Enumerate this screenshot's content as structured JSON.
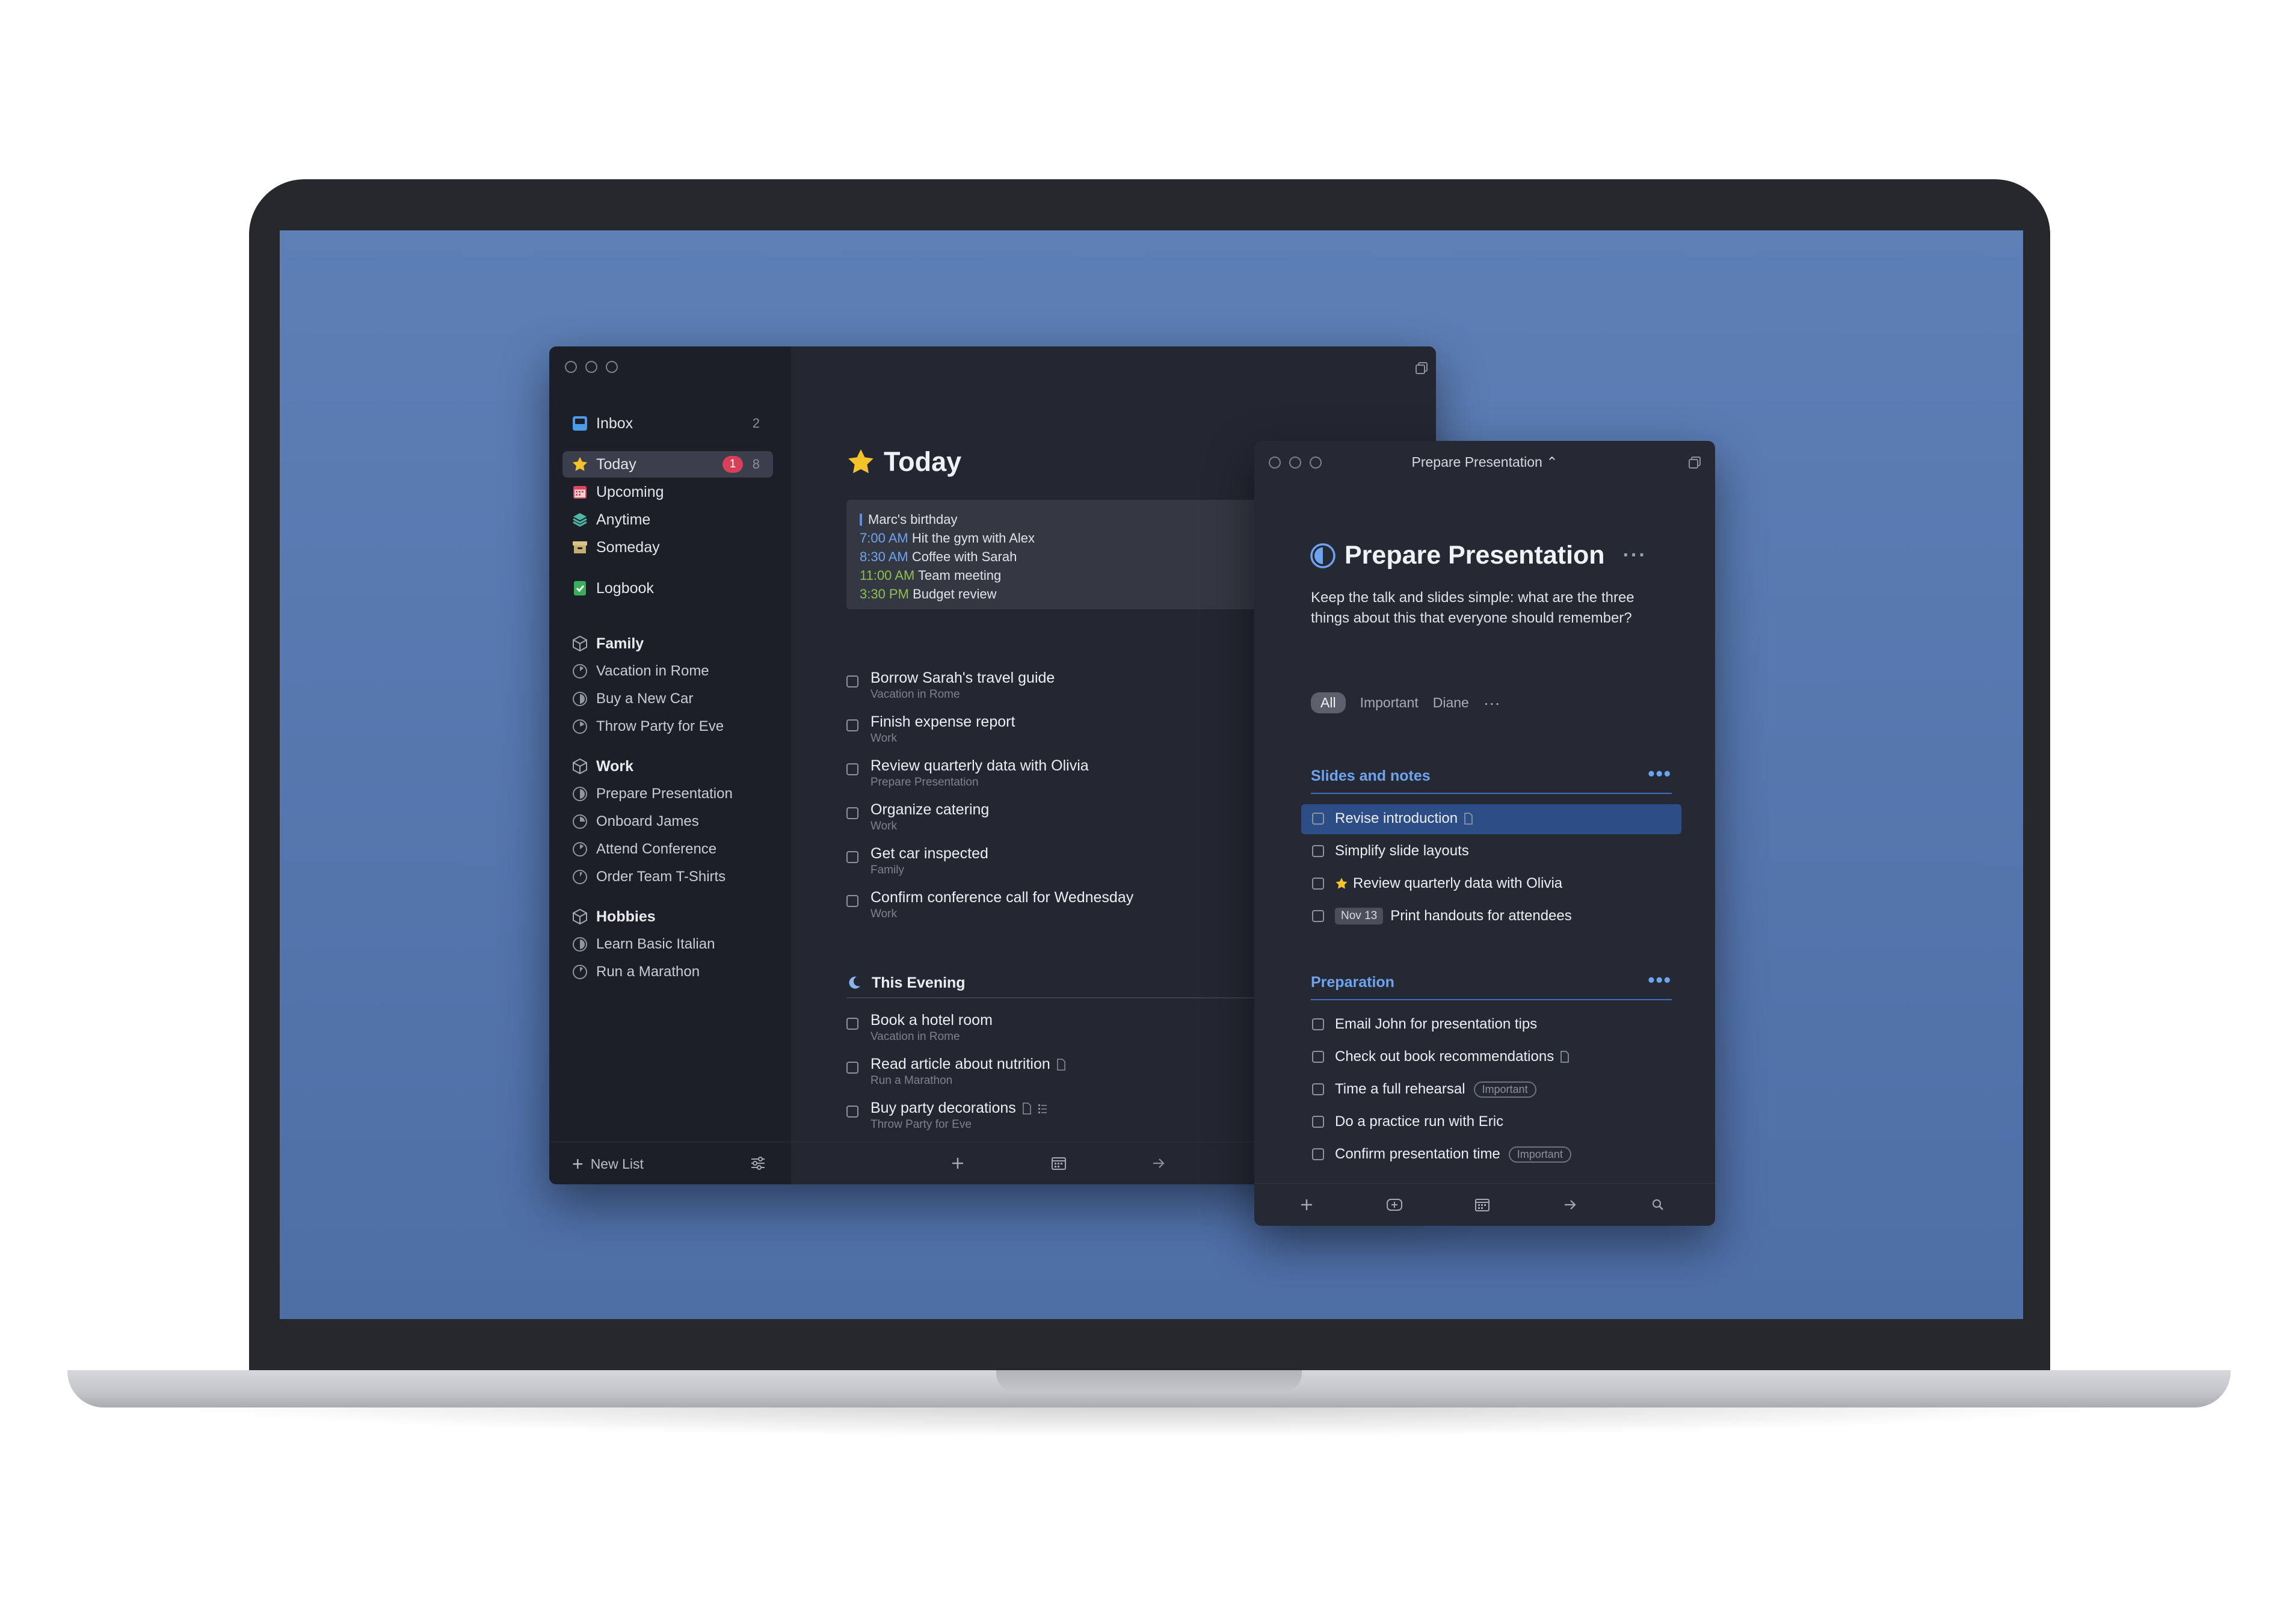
{
  "colors": {
    "accent": "#6ea3ef",
    "today_star": "#f4c22b",
    "badge": "#d8405a",
    "desktop": "#5577b0"
  },
  "sidebar": {
    "inbox": {
      "label": "Inbox",
      "count": "2",
      "icon": "inbox-icon"
    },
    "today": {
      "label": "Today",
      "badge": "1",
      "count": "8",
      "icon": "star-icon"
    },
    "upcoming": {
      "label": "Upcoming",
      "icon": "calendar-icon"
    },
    "anytime": {
      "label": "Anytime",
      "icon": "layers-icon"
    },
    "someday": {
      "label": "Someday",
      "icon": "archive-box-icon"
    },
    "logbook": {
      "label": "Logbook",
      "icon": "logbook-check-icon"
    },
    "areas": [
      {
        "name": "Family",
        "projects": [
          "Vacation in Rome",
          "Buy a New Car",
          "Throw Party for Eve"
        ]
      },
      {
        "name": "Work",
        "projects": [
          "Prepare Presentation",
          "Onboard James",
          "Attend Conference",
          "Order Team T-Shirts"
        ]
      },
      {
        "name": "Hobbies",
        "projects": [
          "Learn Basic Italian",
          "Run a Marathon"
        ]
      }
    ],
    "new_list": "New List"
  },
  "today": {
    "title": "Today",
    "calendar": [
      {
        "time": "",
        "text": "Marc's birthday"
      },
      {
        "time": "7:00 AM",
        "text": "Hit the gym with Alex"
      },
      {
        "time": "8:30 AM",
        "text": "Coffee with Sarah"
      },
      {
        "time": "11:00 AM",
        "text": "Team meeting"
      },
      {
        "time": "3:30 PM",
        "text": "Budget review"
      }
    ],
    "todos": [
      {
        "title": "Borrow Sarah's travel guide",
        "project": "Vacation in Rome"
      },
      {
        "title": "Finish expense report",
        "project": "Work"
      },
      {
        "title": "Review quarterly data with Olivia",
        "project": "Prepare Presentation"
      },
      {
        "title": "Organize catering",
        "project": "Work"
      },
      {
        "title": "Get car inspected",
        "project": "Family"
      },
      {
        "title": "Confirm conference call for Wednesday",
        "project": "Work"
      }
    ],
    "evening_label": "This Evening",
    "evening_todos": [
      {
        "title": "Book a hotel room",
        "project": "Vacation in Rome"
      },
      {
        "title": "Read article about nutrition",
        "project": "Run a Marathon"
      },
      {
        "title": "Buy party decorations",
        "project": "Throw Party for Eve"
      }
    ]
  },
  "detail": {
    "window_title": "Prepare Presentation ⌃",
    "title": "Prepare Presentation",
    "more": "···",
    "notes": "Keep the talk and slides simple: what are the three things about this that everyone should remember?",
    "tags": [
      "All",
      "Important",
      "Diane"
    ],
    "tags_more": "···",
    "headings": [
      {
        "title": "Slides and notes",
        "more": "•••",
        "todos": [
          {
            "title": "Revise introduction"
          },
          {
            "title": "Simplify slide layouts"
          },
          {
            "title": "Review quarterly data with Olivia"
          },
          {
            "title": "Print handouts for attendees",
            "date": "Nov 13"
          }
        ]
      },
      {
        "title": "Preparation",
        "more": "•••",
        "todos": [
          {
            "title": "Email John for presentation tips"
          },
          {
            "title": "Check out book recommendations"
          },
          {
            "title": "Time a full rehearsal",
            "tag": "Important"
          },
          {
            "title": "Do a practice run with Eric"
          },
          {
            "title": "Confirm presentation time",
            "tag": "Important"
          }
        ]
      }
    ]
  }
}
